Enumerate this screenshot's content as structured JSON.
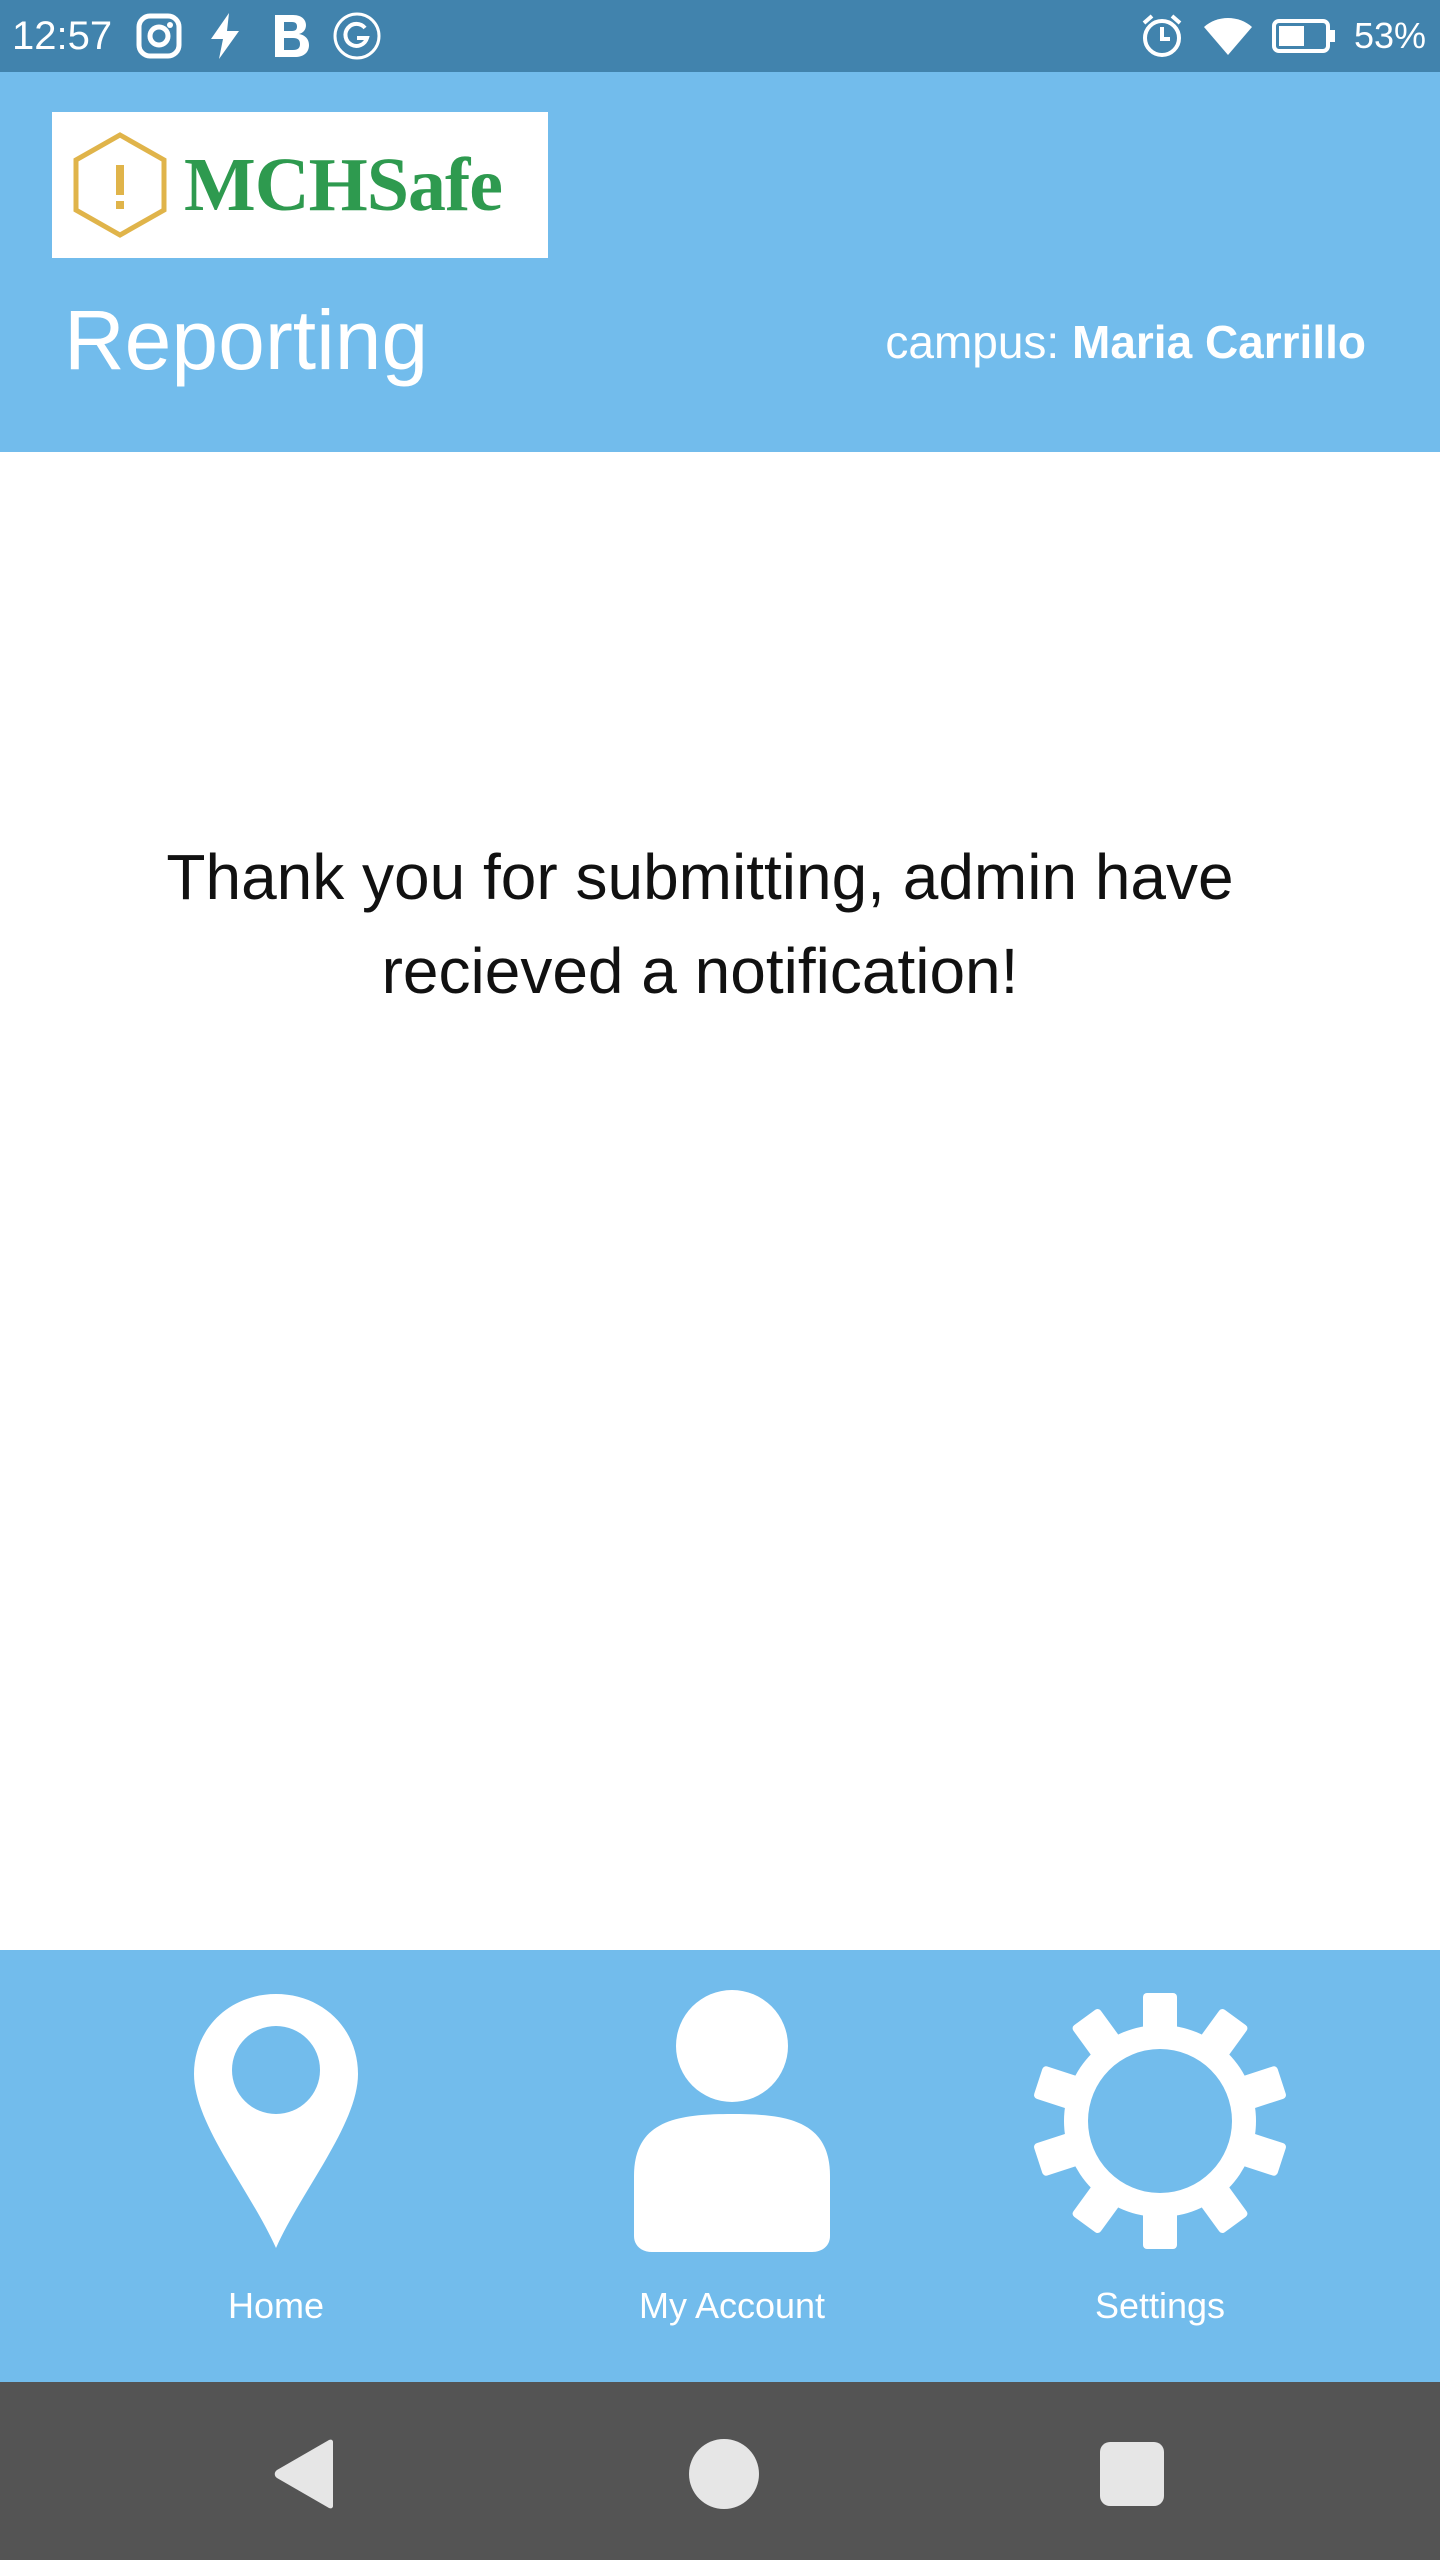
{
  "status_bar": {
    "time": "12:57",
    "battery_percent": "53%",
    "left_icons": [
      "instagram-icon",
      "flash-icon",
      "b-icon",
      "g-icon"
    ],
    "right_icons": [
      "alarm-icon",
      "wifi-icon",
      "battery-icon"
    ]
  },
  "header": {
    "logo_text": "MCHSafe",
    "title": "Reporting",
    "campus_label": "campus:",
    "campus_name": "Maria Carrillo",
    "background_color": "#72bcec"
  },
  "main": {
    "message": "Thank you for submitting, admin have recieved a notification!"
  },
  "tabs": [
    {
      "label": "Home",
      "icon": "location-pin-icon"
    },
    {
      "label": "My Account",
      "icon": "user-icon"
    },
    {
      "label": "Settings",
      "icon": "gear-icon"
    }
  ],
  "nav_bar": {
    "buttons": [
      "back-icon",
      "home-circle-icon",
      "recents-square-icon"
    ]
  }
}
